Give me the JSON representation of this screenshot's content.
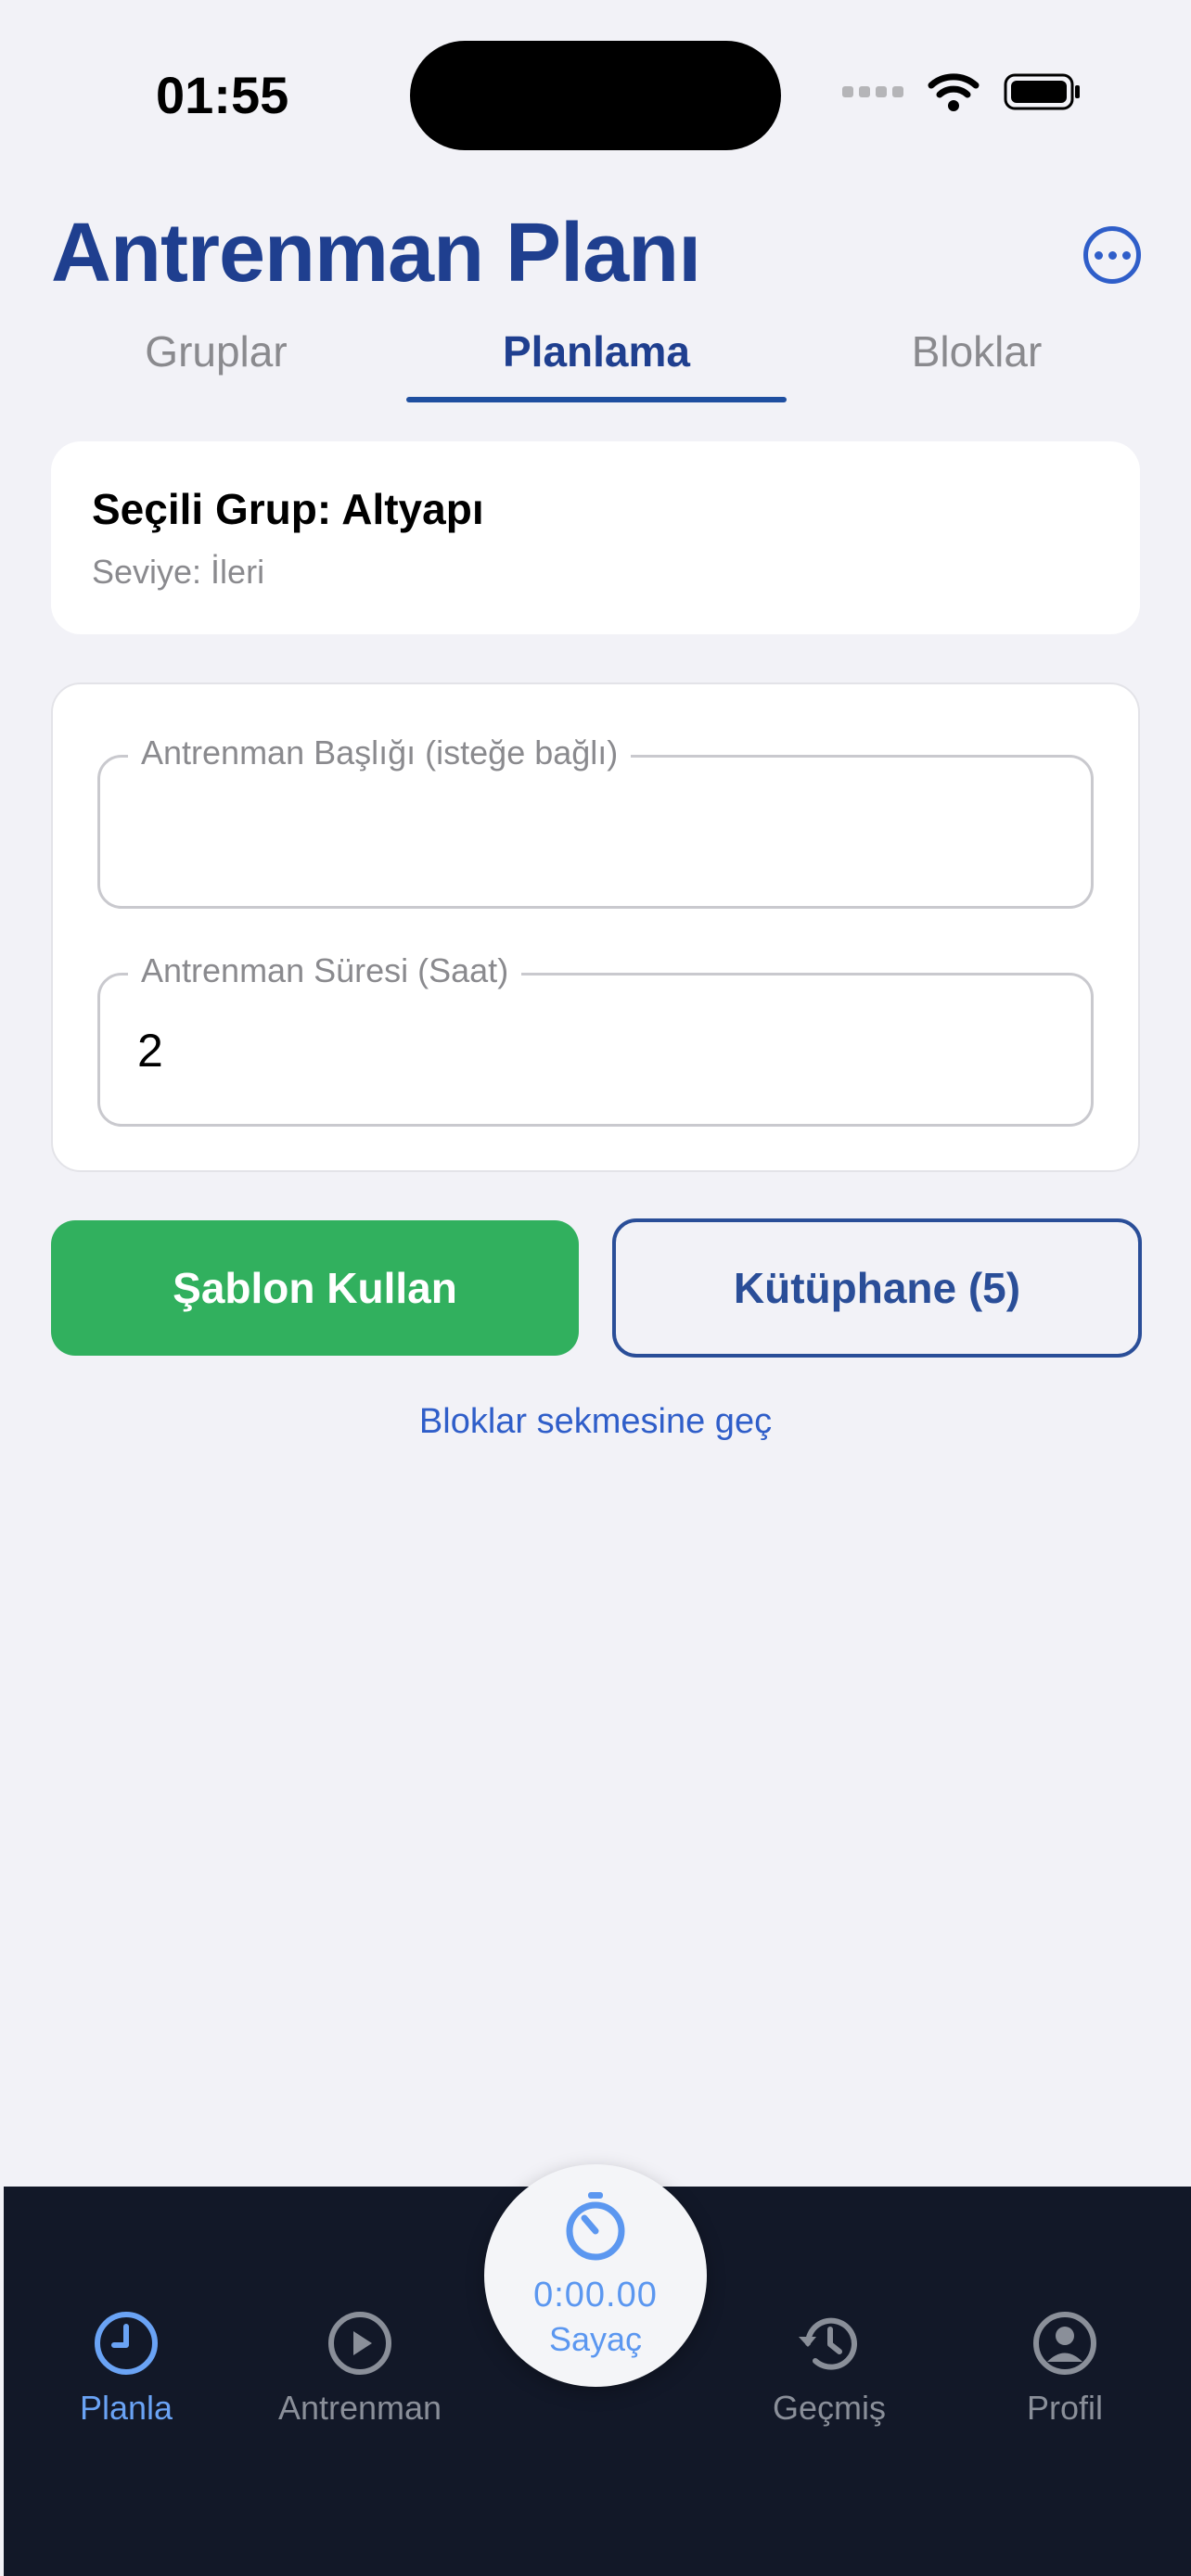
{
  "status_bar": {
    "time": "01:55"
  },
  "header": {
    "title": "Antrenman Planı"
  },
  "tabs": [
    {
      "label": "Gruplar",
      "active": false
    },
    {
      "label": "Planlama",
      "active": true
    },
    {
      "label": "Bloklar",
      "active": false
    }
  ],
  "group_card": {
    "title": "Seçili Grup: Altyapı",
    "level": "Seviye: İleri"
  },
  "form": {
    "title_field": {
      "label": "Antrenman Başlığı (isteğe bağlı)",
      "value": ""
    },
    "duration_field": {
      "label": "Antrenman Süresi (Saat)",
      "value": "2"
    }
  },
  "actions": {
    "template_button": "Şablon Kullan",
    "library_button": "Kütüphane (5)",
    "blocks_link": "Bloklar sekmesine geç"
  },
  "bottom_nav": {
    "items": [
      {
        "label": "Planla",
        "icon": "clock-icon",
        "active": true
      },
      {
        "label": "Antrenman",
        "icon": "play-circle-icon",
        "active": false
      },
      {
        "label": "Geçmiş",
        "icon": "history-icon",
        "active": false
      },
      {
        "label": "Profil",
        "icon": "person-circle-icon",
        "active": false
      }
    ],
    "timer": {
      "value": "0:00.00",
      "label": "Sayaç"
    }
  },
  "colors": {
    "primary": "#1f3f8f",
    "accent_blue": "#2f5ec9",
    "success_green": "#31b05e",
    "nav_background": "#121828",
    "nav_active": "#6aa3f5"
  }
}
